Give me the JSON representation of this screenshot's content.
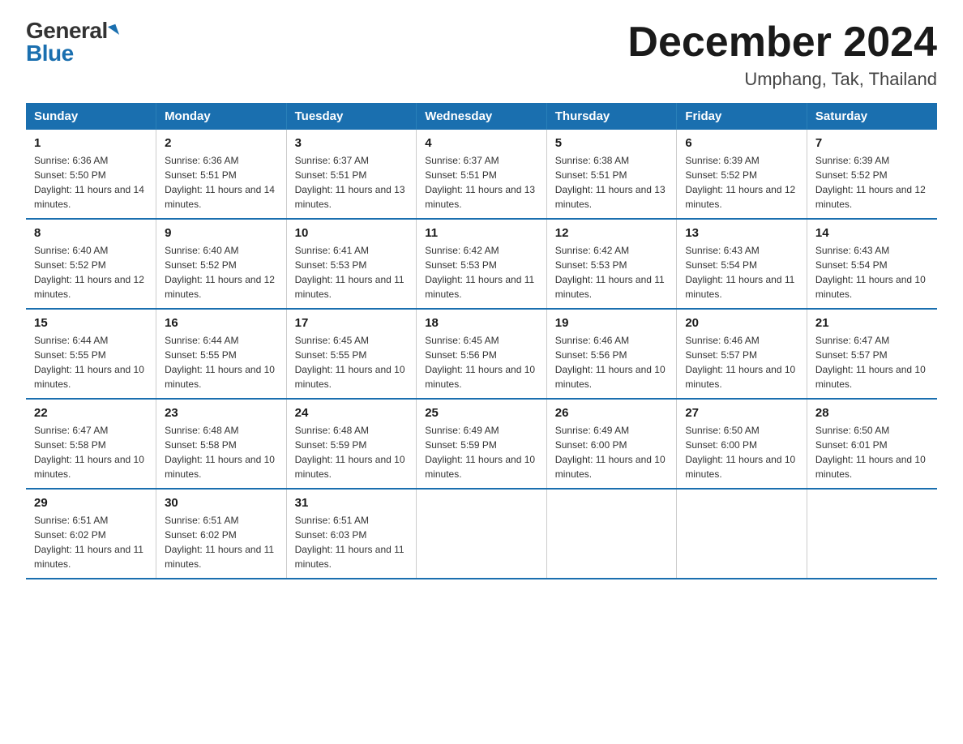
{
  "logo": {
    "general": "General",
    "blue": "Blue"
  },
  "title": {
    "month": "December 2024",
    "location": "Umphang, Tak, Thailand"
  },
  "days_of_week": [
    "Sunday",
    "Monday",
    "Tuesday",
    "Wednesday",
    "Thursday",
    "Friday",
    "Saturday"
  ],
  "weeks": [
    [
      {
        "day": "1",
        "sunrise": "6:36 AM",
        "sunset": "5:50 PM",
        "daylight": "11 hours and 14 minutes."
      },
      {
        "day": "2",
        "sunrise": "6:36 AM",
        "sunset": "5:51 PM",
        "daylight": "11 hours and 14 minutes."
      },
      {
        "day": "3",
        "sunrise": "6:37 AM",
        "sunset": "5:51 PM",
        "daylight": "11 hours and 13 minutes."
      },
      {
        "day": "4",
        "sunrise": "6:37 AM",
        "sunset": "5:51 PM",
        "daylight": "11 hours and 13 minutes."
      },
      {
        "day": "5",
        "sunrise": "6:38 AM",
        "sunset": "5:51 PM",
        "daylight": "11 hours and 13 minutes."
      },
      {
        "day": "6",
        "sunrise": "6:39 AM",
        "sunset": "5:52 PM",
        "daylight": "11 hours and 12 minutes."
      },
      {
        "day": "7",
        "sunrise": "6:39 AM",
        "sunset": "5:52 PM",
        "daylight": "11 hours and 12 minutes."
      }
    ],
    [
      {
        "day": "8",
        "sunrise": "6:40 AM",
        "sunset": "5:52 PM",
        "daylight": "11 hours and 12 minutes."
      },
      {
        "day": "9",
        "sunrise": "6:40 AM",
        "sunset": "5:52 PM",
        "daylight": "11 hours and 12 minutes."
      },
      {
        "day": "10",
        "sunrise": "6:41 AM",
        "sunset": "5:53 PM",
        "daylight": "11 hours and 11 minutes."
      },
      {
        "day": "11",
        "sunrise": "6:42 AM",
        "sunset": "5:53 PM",
        "daylight": "11 hours and 11 minutes."
      },
      {
        "day": "12",
        "sunrise": "6:42 AM",
        "sunset": "5:53 PM",
        "daylight": "11 hours and 11 minutes."
      },
      {
        "day": "13",
        "sunrise": "6:43 AM",
        "sunset": "5:54 PM",
        "daylight": "11 hours and 11 minutes."
      },
      {
        "day": "14",
        "sunrise": "6:43 AM",
        "sunset": "5:54 PM",
        "daylight": "11 hours and 10 minutes."
      }
    ],
    [
      {
        "day": "15",
        "sunrise": "6:44 AM",
        "sunset": "5:55 PM",
        "daylight": "11 hours and 10 minutes."
      },
      {
        "day": "16",
        "sunrise": "6:44 AM",
        "sunset": "5:55 PM",
        "daylight": "11 hours and 10 minutes."
      },
      {
        "day": "17",
        "sunrise": "6:45 AM",
        "sunset": "5:55 PM",
        "daylight": "11 hours and 10 minutes."
      },
      {
        "day": "18",
        "sunrise": "6:45 AM",
        "sunset": "5:56 PM",
        "daylight": "11 hours and 10 minutes."
      },
      {
        "day": "19",
        "sunrise": "6:46 AM",
        "sunset": "5:56 PM",
        "daylight": "11 hours and 10 minutes."
      },
      {
        "day": "20",
        "sunrise": "6:46 AM",
        "sunset": "5:57 PM",
        "daylight": "11 hours and 10 minutes."
      },
      {
        "day": "21",
        "sunrise": "6:47 AM",
        "sunset": "5:57 PM",
        "daylight": "11 hours and 10 minutes."
      }
    ],
    [
      {
        "day": "22",
        "sunrise": "6:47 AM",
        "sunset": "5:58 PM",
        "daylight": "11 hours and 10 minutes."
      },
      {
        "day": "23",
        "sunrise": "6:48 AM",
        "sunset": "5:58 PM",
        "daylight": "11 hours and 10 minutes."
      },
      {
        "day": "24",
        "sunrise": "6:48 AM",
        "sunset": "5:59 PM",
        "daylight": "11 hours and 10 minutes."
      },
      {
        "day": "25",
        "sunrise": "6:49 AM",
        "sunset": "5:59 PM",
        "daylight": "11 hours and 10 minutes."
      },
      {
        "day": "26",
        "sunrise": "6:49 AM",
        "sunset": "6:00 PM",
        "daylight": "11 hours and 10 minutes."
      },
      {
        "day": "27",
        "sunrise": "6:50 AM",
        "sunset": "6:00 PM",
        "daylight": "11 hours and 10 minutes."
      },
      {
        "day": "28",
        "sunrise": "6:50 AM",
        "sunset": "6:01 PM",
        "daylight": "11 hours and 10 minutes."
      }
    ],
    [
      {
        "day": "29",
        "sunrise": "6:51 AM",
        "sunset": "6:02 PM",
        "daylight": "11 hours and 11 minutes."
      },
      {
        "day": "30",
        "sunrise": "6:51 AM",
        "sunset": "6:02 PM",
        "daylight": "11 hours and 11 minutes."
      },
      {
        "day": "31",
        "sunrise": "6:51 AM",
        "sunset": "6:03 PM",
        "daylight": "11 hours and 11 minutes."
      },
      null,
      null,
      null,
      null
    ]
  ]
}
